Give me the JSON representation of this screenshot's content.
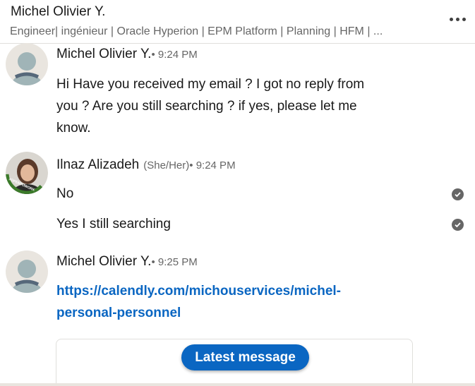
{
  "header": {
    "name": "Michel Olivier Y.",
    "subtitle": "Engineer| ingénieur | Oracle Hyperion | EPM Platform | Planning | HFM | ..."
  },
  "messages": [
    {
      "sender": "Michel Olivier Y.",
      "meta": " • 9:24 PM",
      "lines": [
        "Hi Have you received my email ? I got no reply from",
        "you ? Are you still searching ? if yes, please let me",
        "know."
      ]
    },
    {
      "sender": "Ilnaz Alizadeh",
      "pronoun": "(She/Her)",
      "meta": " • 9:24 PM",
      "badge": "#OPENTOWORK",
      "items": [
        "No",
        "Yes I still searching"
      ]
    },
    {
      "sender": "Michel Olivier Y.",
      "meta": " • 9:25 PM",
      "link_lines": [
        "https://calendly.com/michouservices/michel-",
        "personal-personnel"
      ]
    }
  ],
  "latest_button": "Latest message",
  "colors": {
    "link": "#0a66c2",
    "open_to_work": "#3b7a2a"
  },
  "icons": [
    "more-icon",
    "person-placeholder-icon",
    "check-circle-icon"
  ]
}
